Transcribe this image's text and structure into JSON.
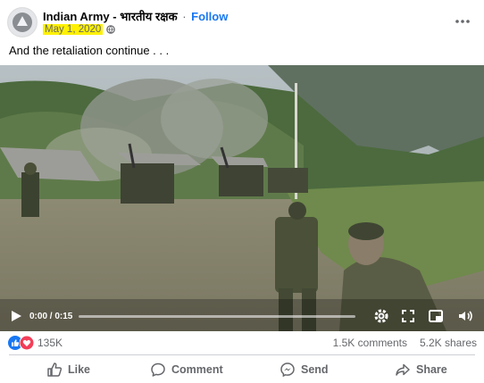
{
  "post": {
    "page_name": "Indian Army - भारतीय रक्षक",
    "separator": "·",
    "follow_label": "Follow",
    "date": "May 1, 2020",
    "caption": "And the retaliation continue . . ."
  },
  "video": {
    "time": "0:00 / 0:15",
    "progress_fraction": 0.0
  },
  "stats": {
    "reactions_count": "135K",
    "comments": "1.5K comments",
    "shares": "5.2K shares"
  },
  "actions": {
    "like": "Like",
    "comment": "Comment",
    "send": "Send",
    "share": "Share"
  },
  "colors": {
    "accent": "#1877f2",
    "date_highlight": "#fff100",
    "secondary_text": "#65676b"
  }
}
